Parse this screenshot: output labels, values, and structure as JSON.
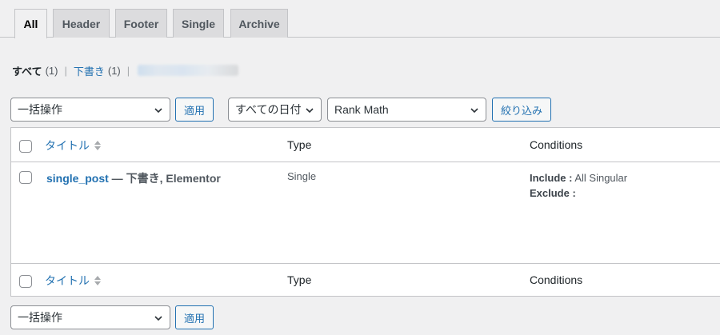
{
  "tabs": [
    {
      "label": "All",
      "active": true
    },
    {
      "label": "Header",
      "active": false
    },
    {
      "label": "Footer",
      "active": false
    },
    {
      "label": "Single",
      "active": false
    },
    {
      "label": "Archive",
      "active": false
    }
  ],
  "status": {
    "all_label": "すべて",
    "all_count": "(1)",
    "sep1": "|",
    "draft_label": "下書き",
    "draft_count": "(1)",
    "sep2": "|"
  },
  "toolbar_top": {
    "bulk_action": "一括操作",
    "apply": "適用",
    "date_filter": "すべての日付",
    "seo_filter": "Rank Math",
    "filter_button": "絞り込み"
  },
  "table": {
    "columns": {
      "title": "タイトル",
      "type": "Type",
      "conditions": "Conditions"
    },
    "rows": [
      {
        "title": "single_post",
        "state": " — 下書き, Elementor",
        "type": "Single",
        "include_label": "Include :",
        "include_value": " All Singular",
        "exclude_label": "Exclude :"
      }
    ]
  },
  "toolbar_bottom": {
    "bulk_action": "一括操作",
    "apply": "適用"
  },
  "colors": {
    "link": "#2271b1",
    "background": "#f0f0f1",
    "border": "#c3c4c7"
  }
}
